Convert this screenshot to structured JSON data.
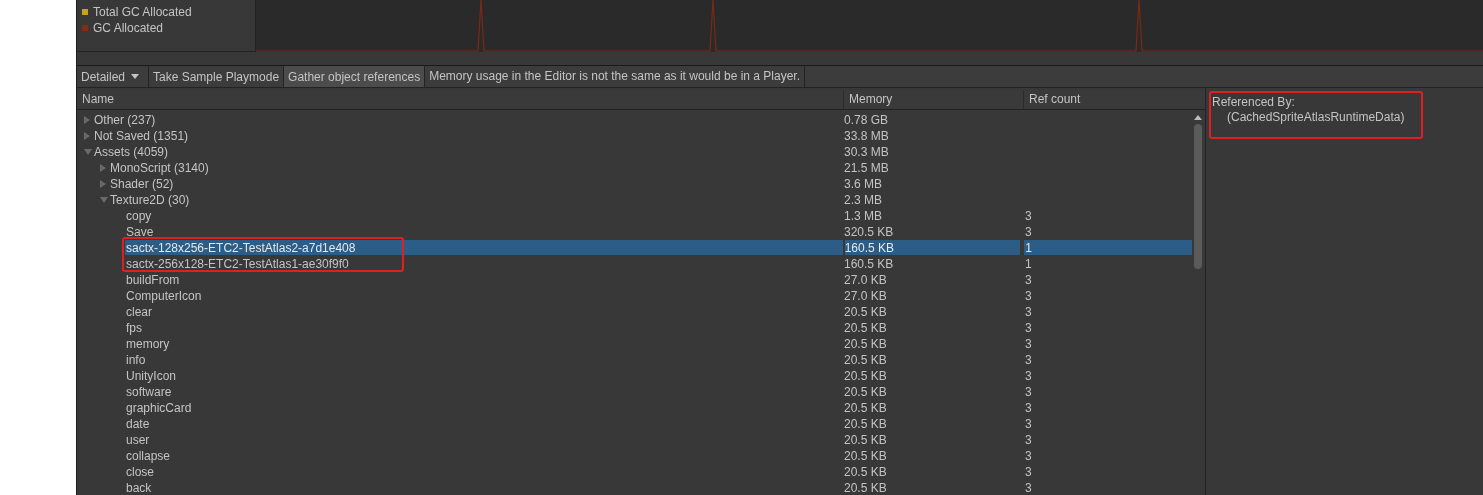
{
  "legend": [
    {
      "label": "Total GC Allocated",
      "color": "#c8a020"
    },
    {
      "label": "GC Allocated",
      "color": "#8a2a10"
    }
  ],
  "toolbar": {
    "view_mode": "Detailed",
    "buttons": [
      {
        "label": "Take Sample Playmode",
        "selected": false
      },
      {
        "label": "Gather object references",
        "selected": true
      }
    ],
    "message": "Memory usage in the Editor is not the same as it would be in a Player."
  },
  "table": {
    "columns": [
      "Name",
      "Memory",
      "Ref count"
    ],
    "rows": [
      {
        "kind": "group",
        "name": "Other (237)",
        "memory": "0.78 GB",
        "expanded": false
      },
      {
        "kind": "group",
        "name": "Not Saved (1351)",
        "memory": "33.8 MB",
        "expanded": false
      },
      {
        "kind": "group",
        "name": "Assets (4059)",
        "memory": "30.3 MB",
        "expanded": true,
        "children": [
          {
            "kind": "group",
            "name": "MonoScript (3140)",
            "memory": "21.5 MB",
            "expanded": false
          },
          {
            "kind": "group",
            "name": "Shader (52)",
            "memory": "3.6 MB",
            "expanded": false
          },
          {
            "kind": "group",
            "name": "Texture2D (30)",
            "memory": "2.3 MB",
            "expanded": true,
            "children": [
              {
                "kind": "item",
                "name": "copy",
                "memory": "1.3 MB",
                "ref_count": "3",
                "selected": false,
                "outlined": false
              },
              {
                "kind": "item",
                "name": "Save",
                "memory": "320.5 KB",
                "ref_count": "3",
                "selected": false,
                "outlined": false
              },
              {
                "kind": "item",
                "name": "sactx-128x256-ETC2-TestAtlas2-a7d1e408",
                "memory": "160.5 KB",
                "ref_count": "1",
                "selected": true,
                "outlined": true
              },
              {
                "kind": "item",
                "name": "sactx-256x128-ETC2-TestAtlas1-ae30f9f0",
                "memory": "160.5 KB",
                "ref_count": "1",
                "selected": false,
                "outlined": true
              },
              {
                "kind": "item",
                "name": "buildFrom",
                "memory": "27.0 KB",
                "ref_count": "3",
                "selected": false,
                "outlined": false
              },
              {
                "kind": "item",
                "name": "ComputerIcon",
                "memory": "27.0 KB",
                "ref_count": "3",
                "selected": false,
                "outlined": false
              },
              {
                "kind": "item",
                "name": "clear",
                "memory": "20.5 KB",
                "ref_count": "3",
                "selected": false,
                "outlined": false
              },
              {
                "kind": "item",
                "name": "fps",
                "memory": "20.5 KB",
                "ref_count": "3",
                "selected": false,
                "outlined": false
              },
              {
                "kind": "item",
                "name": "memory",
                "memory": "20.5 KB",
                "ref_count": "3",
                "selected": false,
                "outlined": false
              },
              {
                "kind": "item",
                "name": "info",
                "memory": "20.5 KB",
                "ref_count": "3",
                "selected": false,
                "outlined": false
              },
              {
                "kind": "item",
                "name": "UnityIcon",
                "memory": "20.5 KB",
                "ref_count": "3",
                "selected": false,
                "outlined": false
              },
              {
                "kind": "item",
                "name": "software",
                "memory": "20.5 KB",
                "ref_count": "3",
                "selected": false,
                "outlined": false
              },
              {
                "kind": "item",
                "name": "graphicCard",
                "memory": "20.5 KB",
                "ref_count": "3",
                "selected": false,
                "outlined": false
              },
              {
                "kind": "item",
                "name": "date",
                "memory": "20.5 KB",
                "ref_count": "3",
                "selected": false,
                "outlined": false
              },
              {
                "kind": "item",
                "name": "user",
                "memory": "20.5 KB",
                "ref_count": "3",
                "selected": false,
                "outlined": false
              },
              {
                "kind": "item",
                "name": "collapse",
                "memory": "20.5 KB",
                "ref_count": "3",
                "selected": false,
                "outlined": false
              },
              {
                "kind": "item",
                "name": "close",
                "memory": "20.5 KB",
                "ref_count": "3",
                "selected": false,
                "outlined": false
              },
              {
                "kind": "item",
                "name": "back",
                "memory": "20.5 KB",
                "ref_count": "3",
                "selected": false,
                "outlined": false
              }
            ]
          }
        ]
      }
    ]
  },
  "referenced_by": {
    "title": "Referenced By:",
    "items": [
      "(CachedSpriteAtlasRuntimeData)"
    ],
    "outlined": true
  }
}
